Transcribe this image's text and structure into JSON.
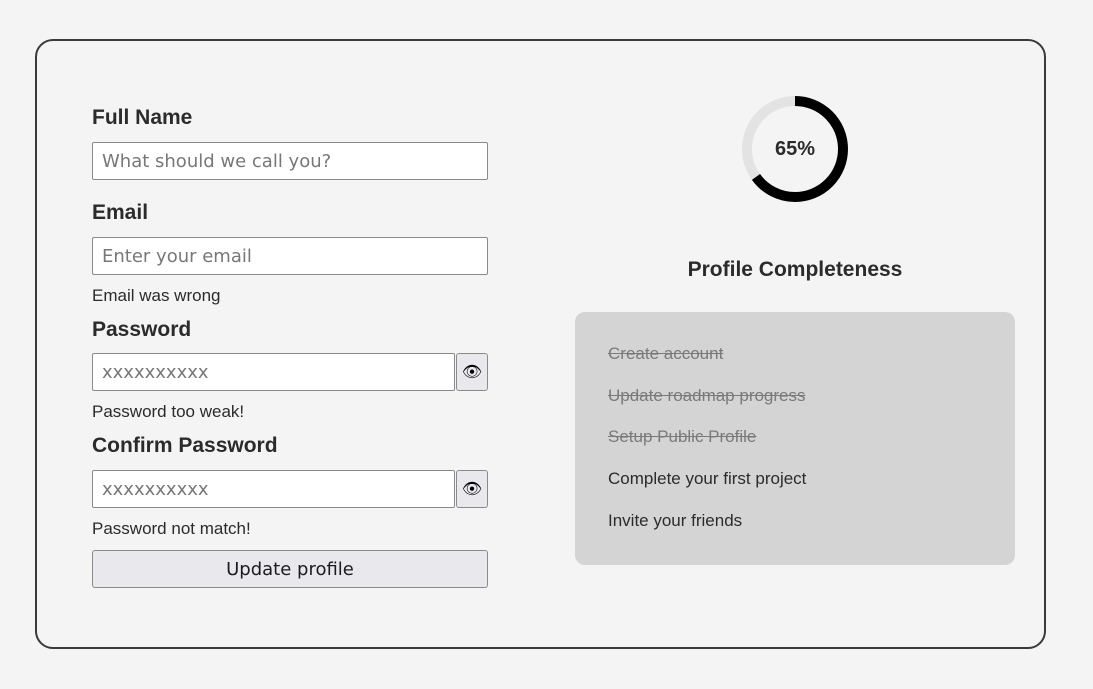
{
  "form": {
    "full_name": {
      "label": "Full Name",
      "placeholder": "What should we call you?",
      "value": ""
    },
    "email": {
      "label": "Email",
      "placeholder": "Enter your email",
      "value": "",
      "error": "Email was wrong"
    },
    "password": {
      "label": "Password",
      "placeholder": "xxxxxxxxxx",
      "value": "",
      "error": "Password too weak!",
      "toggle_icon": "eye-icon"
    },
    "confirm_password": {
      "label": "Confirm Password",
      "placeholder": "xxxxxxxxxx",
      "value": "",
      "error": "Password not match!",
      "toggle_icon": "eye-icon"
    },
    "submit_label": "Update profile"
  },
  "profile": {
    "completeness_percent": 65,
    "completeness_text": "65%",
    "title": "Profile Completeness",
    "ring_color": "#000000",
    "ring_track_color": "#e3e3e3",
    "tasks": [
      {
        "label": "Create account",
        "done": true
      },
      {
        "label": "Update roadmap progress",
        "done": true
      },
      {
        "label": "Setup Public Profile",
        "done": true
      },
      {
        "label": "Complete your first project",
        "done": false
      },
      {
        "label": "Invite your friends",
        "done": false
      }
    ]
  }
}
